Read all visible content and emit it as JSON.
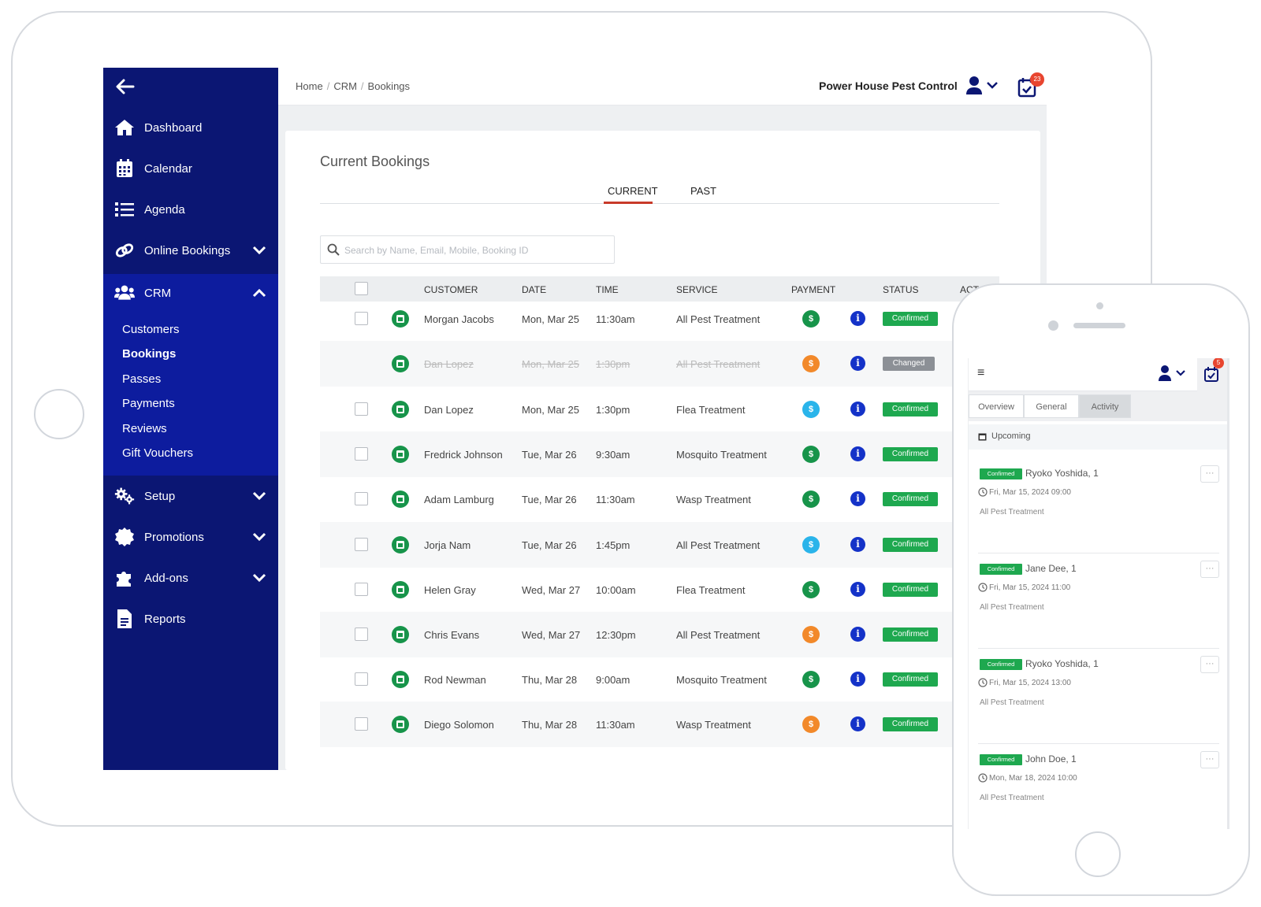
{
  "sidebar": {
    "items": [
      {
        "label": "Dashboard",
        "icon": "home-icon"
      },
      {
        "label": "Calendar",
        "icon": "calendar-icon"
      },
      {
        "label": "Agenda",
        "icon": "list-icon"
      },
      {
        "label": "Online Bookings",
        "icon": "link-icon"
      },
      {
        "label": "CRM",
        "icon": "users-icon"
      },
      {
        "label": "Setup",
        "icon": "gears-icon"
      },
      {
        "label": "Promotions",
        "icon": "badge-icon"
      },
      {
        "label": "Add-ons",
        "icon": "puzzle-icon"
      },
      {
        "label": "Reports",
        "icon": "file-icon"
      }
    ],
    "crm_sub": [
      "Customers",
      "Bookings",
      "Passes",
      "Payments",
      "Reviews",
      "Gift Vouchers"
    ],
    "active_sub": "Bookings",
    "colors": {
      "bg": "#0b1673",
      "crm_bg": "#0d1c9e"
    }
  },
  "header": {
    "breadcrumb": [
      "Home",
      "CRM",
      "Bookings"
    ],
    "company": "Power House Pest Control",
    "notif_count": "23"
  },
  "main": {
    "title": "Current Bookings",
    "tabs": [
      "CURRENT",
      "PAST"
    ],
    "active_tab": "CURRENT",
    "search_placeholder": "Search by Name, Email, Mobile, Booking ID",
    "columns": [
      "CUSTOMER",
      "DATE",
      "TIME",
      "SERVICE",
      "PAYMENT",
      "STATUS",
      "ACT"
    ],
    "rows": [
      {
        "customer": "Morgan Jacobs",
        "date": "Mon, Mar 25",
        "time": "11:30am",
        "service": "All Pest Treatment",
        "pay": "green",
        "status": "Confirmed"
      },
      {
        "customer": "Dan Lopez",
        "date": "Mon, Mar 25",
        "time": "1:30pm",
        "service": "All Pest Treatment",
        "pay": "orange",
        "status": "Changed"
      },
      {
        "customer": "Dan Lopez",
        "date": "Mon, Mar 25",
        "time": "1:30pm",
        "service": "Flea Treatment",
        "pay": "blue",
        "status": "Confirmed"
      },
      {
        "customer": "Fredrick Johnson",
        "date": "Tue, Mar 26",
        "time": "9:30am",
        "service": "Mosquito Treatment",
        "pay": "green",
        "status": "Confirmed"
      },
      {
        "customer": "Adam Lamburg",
        "date": "Tue, Mar 26",
        "time": "11:30am",
        "service": "Wasp Treatment",
        "pay": "green",
        "status": "Confirmed"
      },
      {
        "customer": "Jorja Nam",
        "date": "Tue, Mar 26",
        "time": "1:45pm",
        "service": "All Pest Treatment",
        "pay": "blue",
        "status": "Confirmed"
      },
      {
        "customer": "Helen Gray",
        "date": "Wed, Mar 27",
        "time": "10:00am",
        "service": "Flea Treatment",
        "pay": "green",
        "status": "Confirmed"
      },
      {
        "customer": "Chris Evans",
        "date": "Wed, Mar 27",
        "time": "12:30pm",
        "service": "All Pest Treatment",
        "pay": "orange",
        "status": "Confirmed"
      },
      {
        "customer": "Rod Newman",
        "date": "Thu, Mar 28",
        "time": "9:00am",
        "service": "Mosquito Treatment",
        "pay": "green",
        "status": "Confirmed"
      },
      {
        "customer": "Diego Solomon",
        "date": "Thu, Mar 28",
        "time": "11:30am",
        "service": "Wasp Treatment",
        "pay": "orange",
        "status": "Confirmed"
      }
    ],
    "pay_symbol": "$",
    "info_symbol": "i",
    "colors": {
      "green": "#17944a",
      "orange": "#f2892a",
      "blue": "#2ab4ea",
      "confirmed": "#1ea84f",
      "changed": "#8c9096"
    }
  },
  "phone": {
    "notif_count": "5",
    "menu_symbol": "≡",
    "tabs": [
      "Overview",
      "General",
      "Activity"
    ],
    "active_tab": "Activity",
    "section": "Upcoming",
    "items": [
      {
        "status": "Confirmed",
        "name": "Ryoko Yoshida, 1",
        "date": "Fri, Mar 15, 2024 09:00",
        "service": "All Pest Treatment"
      },
      {
        "status": "Confirmed",
        "name": "Jane Dee, 1",
        "date": "Fri, Mar 15, 2024 11:00",
        "service": "All Pest Treatment"
      },
      {
        "status": "Confirmed",
        "name": "Ryoko Yoshida, 1",
        "date": "Fri, Mar 15, 2024 13:00",
        "service": "All Pest Treatment"
      },
      {
        "status": "Confirmed",
        "name": "John Doe, 1",
        "date": "Mon, Mar 18, 2024 10:00",
        "service": "All Pest Treatment"
      }
    ],
    "more_symbol": "···"
  }
}
